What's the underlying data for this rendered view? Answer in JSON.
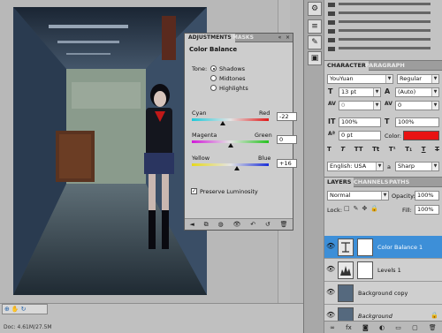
{
  "adjustments": {
    "tab_label": "ADJUSTMENTS",
    "masks_tab_label": "MASKS",
    "heading": "Color Balance",
    "tone_label": "Tone:",
    "tones": [
      "Shadows",
      "Midtones",
      "Highlights"
    ],
    "selected_tone": "Shadows",
    "sliders": [
      {
        "left": "Cyan",
        "right": "Red",
        "value": "-22"
      },
      {
        "left": "Magenta",
        "right": "Green",
        "value": "0"
      },
      {
        "left": "Yellow",
        "right": "Blue",
        "value": "+16"
      }
    ],
    "preserve_label": "Preserve Luminosity",
    "preserve_checked": true
  },
  "character": {
    "tab_label": "CHARACTER",
    "paragraph_tab_label": "PARAGRAPH",
    "font_family": "YouYuan",
    "font_style": "Regular",
    "font_size": "13 pt",
    "leading": "(Auto)",
    "kerning": "0",
    "tracking": "0",
    "vertical_scale": "100%",
    "horizontal_scale": "100%",
    "baseline_shift": "0 pt",
    "color_label": "Color:",
    "color_value": "#e81313",
    "language": "English: USA",
    "anti_alias_label": "a",
    "anti_alias": "Sharp"
  },
  "layers": {
    "tab_label": "LAYERS",
    "channels_tab_label": "CHANNELS",
    "paths_tab_label": "PATHS",
    "blend_mode": "Normal",
    "opacity_label": "Opacity:",
    "opacity": "100%",
    "lock_label": "Lock:",
    "fill_label": "Fill:",
    "fill": "100%",
    "items": [
      {
        "name": "Color Balance 1",
        "type": "adjustment",
        "selected": true
      },
      {
        "name": "Levels 1",
        "type": "adjustment",
        "selected": false
      },
      {
        "name": "Background copy",
        "type": "image",
        "selected": false
      },
      {
        "name": "Background",
        "type": "image",
        "selected": false,
        "locked": true
      }
    ]
  },
  "status": {
    "doc_text": "Doc: 4.61M/27.5M"
  },
  "colors": {
    "accent": "#3d8fd8",
    "panel": "#c9c9c9"
  }
}
